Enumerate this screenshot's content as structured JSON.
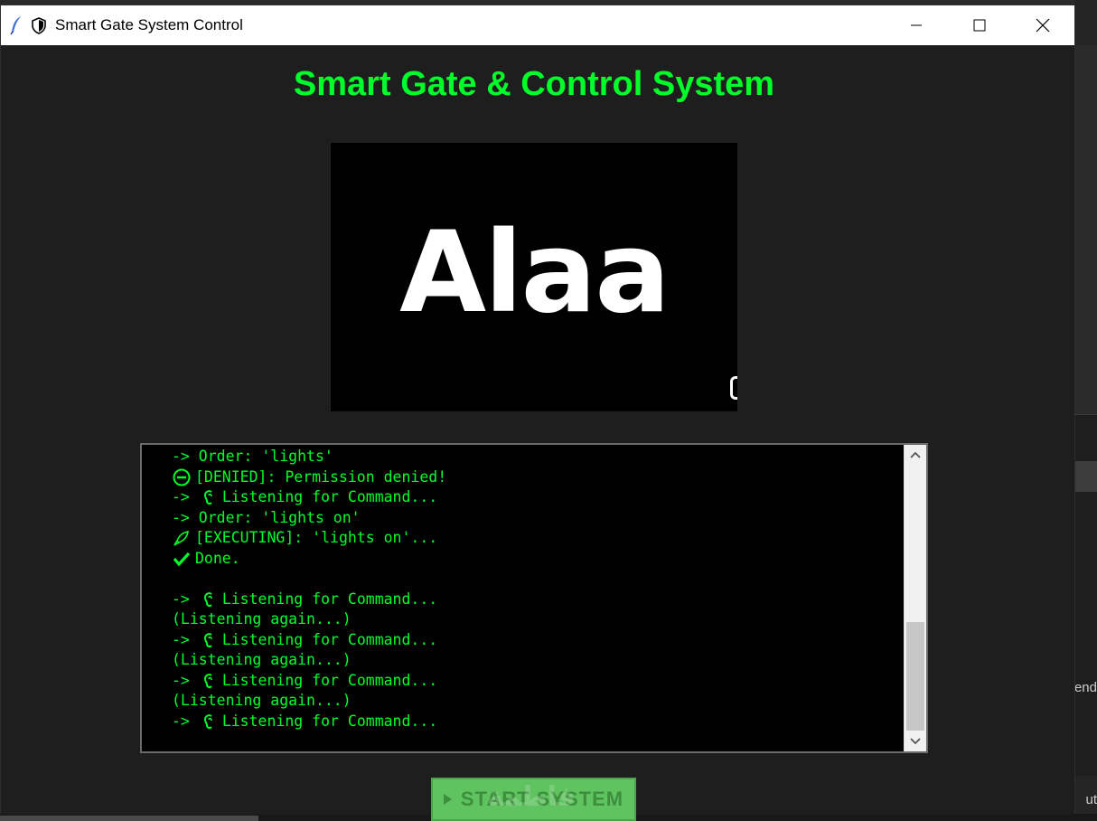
{
  "background": {
    "peek_right_1": "end",
    "peek_right_2": "ut"
  },
  "window": {
    "title": "Smart Gate System Control",
    "controls": [
      "minimize",
      "maximize",
      "close"
    ]
  },
  "app": {
    "heading": "Smart Gate & Control System",
    "camera_text": "Alaa",
    "accent_color": "#00ff2a",
    "log": [
      {
        "icon": "",
        "text": "-> Order: 'lights'"
      },
      {
        "icon": "no-entry-icon",
        "text": "[DENIED]: Permission denied!"
      },
      {
        "icon": "ear-icon",
        "prefix": "->",
        "text": "Listening for Command..."
      },
      {
        "icon": "",
        "text": "-> Order: 'lights on'"
      },
      {
        "icon": "rocket-icon",
        "text": "[EXECUTING]: 'lights on'..."
      },
      {
        "icon": "check-icon",
        "text": "Done."
      },
      {
        "icon": "",
        "text": ""
      },
      {
        "icon": "ear-icon",
        "prefix": "->",
        "text": "Listening for Command..."
      },
      {
        "icon": "",
        "text": "(Listening again...)"
      },
      {
        "icon": "ear-icon",
        "prefix": "->",
        "text": "Listening for Command..."
      },
      {
        "icon": "",
        "text": "(Listening again...)"
      },
      {
        "icon": "ear-icon",
        "prefix": "->",
        "text": "Listening for Command..."
      },
      {
        "icon": "",
        "text": "(Listening again...)"
      },
      {
        "icon": "ear-icon",
        "prefix": "->",
        "text": "Listening for Command..."
      }
    ],
    "start_button_label": "START SYSTEM",
    "start_button_overlay": "فاطمة"
  }
}
